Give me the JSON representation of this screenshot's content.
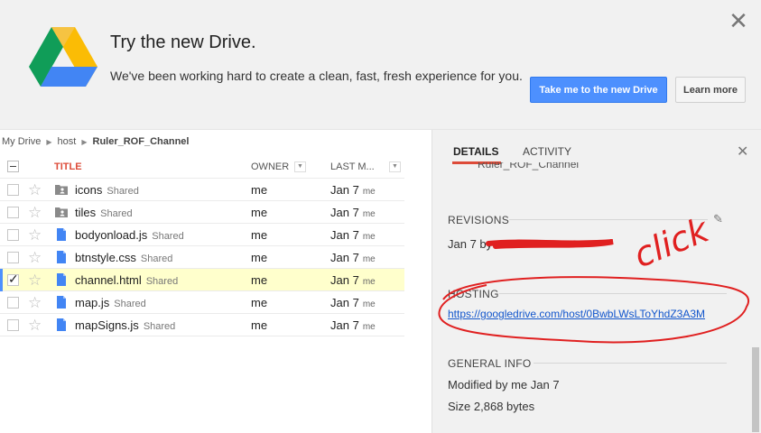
{
  "banner": {
    "title": "Try the new Drive.",
    "description": "We've been working hard to create a clean, fast, fresh experience for you.",
    "primary_button": "Take me to the new Drive",
    "secondary_button": "Learn more",
    "close_icon": "close-icon"
  },
  "breadcrumb": [
    "My Drive",
    "host",
    "Ruler_ROF_Channel"
  ],
  "list": {
    "headers": {
      "title": "TITLE",
      "owner": "OWNER",
      "last_modified": "LAST M..."
    },
    "rows": [
      {
        "name": "icons",
        "type": "folder",
        "shared": "Shared",
        "owner": "me",
        "date": "Jan 7",
        "by": "me",
        "checked": false
      },
      {
        "name": "tiles",
        "type": "folder",
        "shared": "Shared",
        "owner": "me",
        "date": "Jan 7",
        "by": "me",
        "checked": false
      },
      {
        "name": "bodyonload.js",
        "type": "file",
        "shared": "Shared",
        "owner": "me",
        "date": "Jan 7",
        "by": "me",
        "checked": false
      },
      {
        "name": "btnstyle.css",
        "type": "file",
        "shared": "Shared",
        "owner": "me",
        "date": "Jan 7",
        "by": "me",
        "checked": false
      },
      {
        "name": "channel.html",
        "type": "file",
        "shared": "Shared",
        "owner": "me",
        "date": "Jan 7",
        "by": "me",
        "checked": true
      },
      {
        "name": "map.js",
        "type": "file",
        "shared": "Shared",
        "owner": "me",
        "date": "Jan 7",
        "by": "me",
        "checked": false
      },
      {
        "name": "mapSigns.js",
        "type": "file",
        "shared": "Shared",
        "owner": "me",
        "date": "Jan 7",
        "by": "me",
        "checked": false
      }
    ]
  },
  "panel": {
    "tabs": [
      "DETAILS",
      "ACTIVITY"
    ],
    "folder_name": "Ruler_ROF_Channel",
    "revisions_title": "REVISIONS",
    "revisions_text": "Jan 7 by",
    "hosting_title": "HOSTING",
    "hosting_link": "https://googledrive.com/host/0BwbLWsLToYhdZ3A3M",
    "general_title": "GENERAL INFO",
    "modified": "Modified by me Jan 7",
    "size": "Size 2,868 bytes",
    "annotation": "click"
  },
  "colors": {
    "accent_blue": "#4d90fe",
    "title_red": "#dd4b39",
    "annotation_red": "#e02020",
    "selected_row": "#ffffcc"
  }
}
